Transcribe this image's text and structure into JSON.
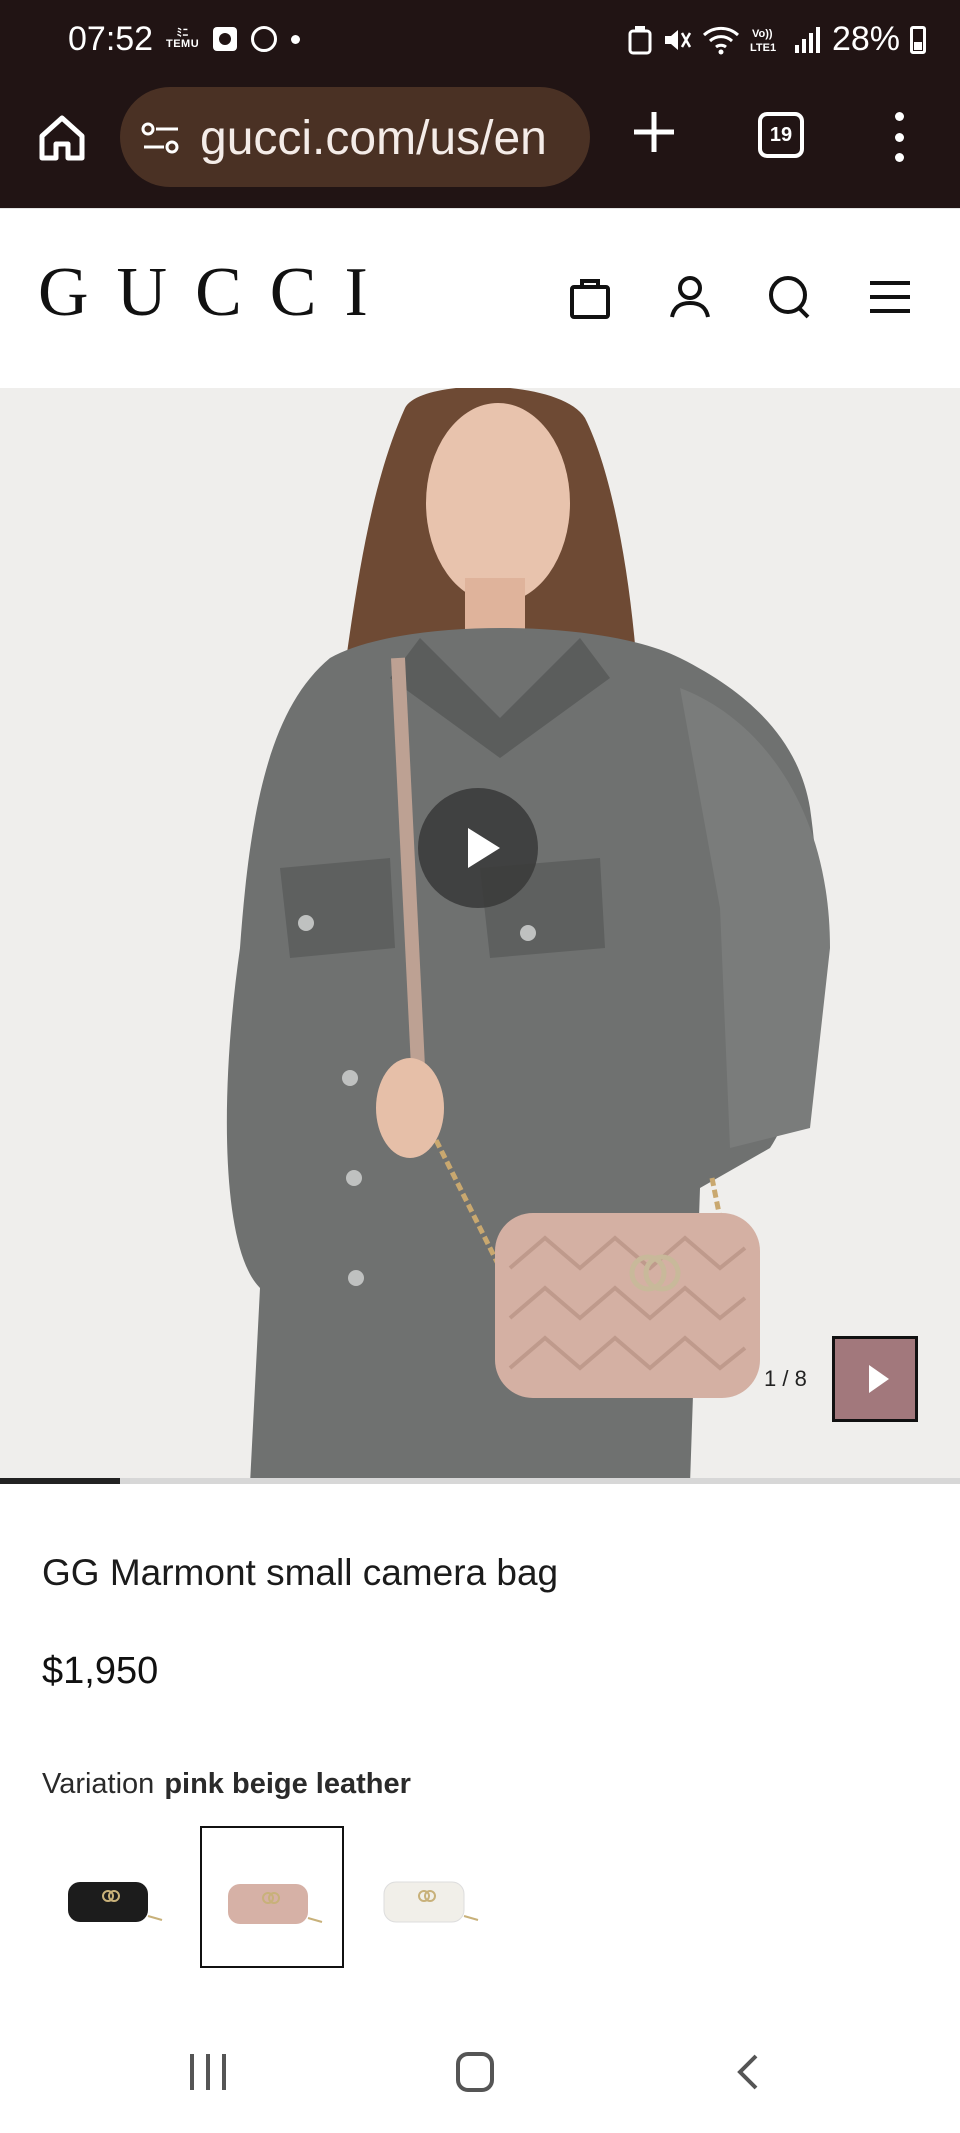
{
  "status_bar": {
    "time": "07:52",
    "temu_label": "TEMU",
    "battery": "28%"
  },
  "browser": {
    "url": "gucci.com/us/en",
    "tab_count": "19",
    "icons": [
      "home-icon",
      "site-settings-icon",
      "plus-icon",
      "tabs-icon",
      "more-menu-icon"
    ]
  },
  "header": {
    "logo": "GUCCI",
    "icons": [
      "shopping-bag-icon",
      "account-icon",
      "search-icon",
      "menu-icon"
    ]
  },
  "media": {
    "counter": "1 / 8",
    "progress": 0.125,
    "accent_color": "#d4b0a3"
  },
  "product": {
    "title": "GG Marmont small camera bag",
    "price": "$1,950",
    "variation_label": "Variation",
    "variation_value": "pink beige leather",
    "variations": [
      {
        "name": "black",
        "color": "#1c1c1c",
        "selected": false
      },
      {
        "name": "pink beige",
        "color": "#d6b1a6",
        "selected": true
      },
      {
        "name": "white",
        "color": "#f1efe9",
        "selected": false
      }
    ]
  }
}
